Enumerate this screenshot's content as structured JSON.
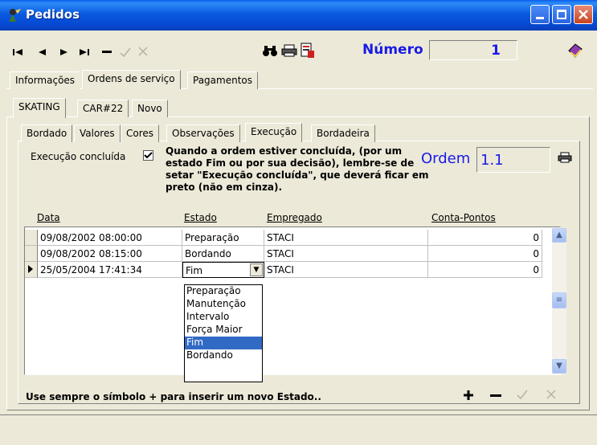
{
  "window": {
    "title": "Pedidos"
  },
  "toolbar": {
    "numero_label": "Número",
    "numero_value": "1"
  },
  "tabs_main": [
    "Informações",
    "Ordens de serviço",
    "Pagamentos"
  ],
  "tabs_sub": [
    "SKATING",
    "CAR#22",
    "Novo"
  ],
  "tabs_detail": [
    "Bordado",
    "Valores",
    "Cores",
    "Observações",
    "Execução",
    "Bordadeira"
  ],
  "execucao": {
    "checkbox_label": "Execução concluída",
    "checkbox_checked": true,
    "note": "Quando a ordem estiver concluída, (por um estado Fim ou por sua decisão), lembre-se de setar \"Execução concluída\", que deverá ficar em preto (não em cinza).",
    "ordem_label": "Ordem",
    "ordem_value": "1.1"
  },
  "grid": {
    "headers": [
      "Data",
      "Estado",
      "Empregado",
      "Conta-Pontos"
    ],
    "rows": [
      {
        "data": "09/08/2002 08:00:00",
        "estado": "Preparação",
        "empregado": "STACI",
        "conta": "0"
      },
      {
        "data": "09/08/2002 08:15:00",
        "estado": "Bordando",
        "empregado": "STACI",
        "conta": "0"
      },
      {
        "data": "25/05/2004 17:41:34",
        "estado": "Fim",
        "empregado": "STACI",
        "conta": "0"
      }
    ]
  },
  "dropdown_options": [
    "Preparação",
    "Manutenção",
    "Intervalo",
    "Força Maior",
    "Fim",
    "Bordando"
  ],
  "dropdown_selected": "Fim",
  "hint": "Use sempre o símbolo + para inserir um novo Estado.."
}
